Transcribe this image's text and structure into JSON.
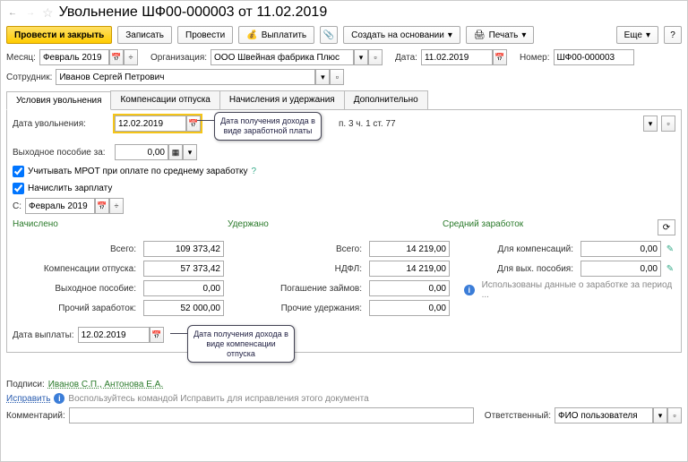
{
  "header": {
    "title": "Увольнение ШФ00-000003 от 11.02.2019"
  },
  "toolbar": {
    "post_close": "Провести и закрыть",
    "save": "Записать",
    "post": "Провести",
    "payout": "Выплатить",
    "create_based": "Создать на основании",
    "print": "Печать",
    "more": "Еще"
  },
  "fields": {
    "month_lbl": "Месяц:",
    "month": "Февраль 2019",
    "org_lbl": "Организация:",
    "org": "ООО Швейная фабрика Плюс",
    "date_lbl": "Дата:",
    "date": "11.02.2019",
    "num_lbl": "Номер:",
    "num": "ШФ00-000003",
    "emp_lbl": "Сотрудник:",
    "emp": "Иванов Сергей Петрович"
  },
  "tabs": {
    "t1": "Условия увольнения",
    "t2": "Компенсации отпуска",
    "t3": "Начисления и удержания",
    "t4": "Дополнительно"
  },
  "dismiss": {
    "date_lbl": "Дата увольнения:",
    "date": "12.02.2019",
    "reason_tail": "п. 3 ч. 1 ст. 77",
    "sev_lbl": "Выходное пособие за:",
    "sev_val": "0,00",
    "mrot_chk": "Учитывать МРОТ при оплате по среднему заработку",
    "salary_chk": "Начислить зарплату",
    "since_lbl": "С:",
    "since": "Февраль 2019"
  },
  "callouts": {
    "c1": "Дата получения дохода в виде заработной платы",
    "c2": "Дата получения дохода в виде компенсации отпуска"
  },
  "cols": {
    "accrued": "Начислено",
    "withheld": "Удержано",
    "avg": "Средний заработок"
  },
  "accrued": {
    "total_lbl": "Всего:",
    "total": "109 373,42",
    "comp_lbl": "Компенсации отпуска:",
    "comp": "57 373,42",
    "sev_lbl": "Выходное пособие:",
    "sev": "0,00",
    "other_lbl": "Прочий заработок:",
    "other": "52 000,00"
  },
  "withheld": {
    "total_lbl": "Всего:",
    "total": "14 219,00",
    "ndfl_lbl": "НДФЛ:",
    "ndfl": "14 219,00",
    "loans_lbl": "Погашение займов:",
    "loans": "0,00",
    "other_lbl": "Прочие удержания:",
    "other": "0,00"
  },
  "avg": {
    "comp_lbl": "Для компенсаций:",
    "comp": "0,00",
    "sev_lbl": "Для вых. пособия:",
    "sev": "0,00",
    "note": "Использованы данные о заработке за период ..."
  },
  "payout": {
    "lbl": "Дата выплаты:",
    "date": "12.02.2019"
  },
  "footer": {
    "signs_lbl": "Подписи:",
    "signs": "Иванов С.П., Антонова Е.А.",
    "fix": "Исправить",
    "fix_note": "Воспользуйтесь командой Исправить для исправления этого документа",
    "comment_lbl": "Комментарий:",
    "resp_lbl": "Ответственный:",
    "resp": "ФИО пользователя"
  }
}
